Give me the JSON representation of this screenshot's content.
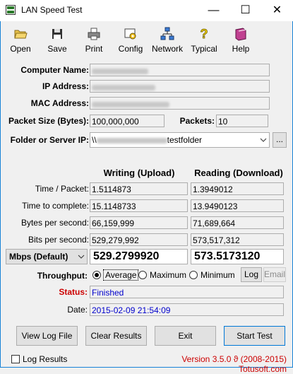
{
  "window": {
    "title": "LAN Speed Test",
    "minimize": "—",
    "maximize": "☐",
    "close": "✕"
  },
  "toolbar": {
    "open": "Open",
    "save": "Save",
    "print": "Print",
    "config": "Config",
    "network": "Network",
    "typical": "Typical",
    "help": "Help"
  },
  "info": {
    "computer_name_label": "Computer Name:",
    "ip_address_label": "IP Address:",
    "mac_address_label": "MAC Address:",
    "packet_size_label": "Packet Size (Bytes):",
    "packet_size_value": "100,000,000",
    "packets_label": "Packets:",
    "packets_value": "10",
    "folder_label": "Folder or Server IP:",
    "folder_prefix": "\\\\",
    "folder_suffix": "testfolder",
    "browse_label": "..."
  },
  "results": {
    "writing_header": "Writing (Upload)",
    "reading_header": "Reading (Download)",
    "time_per_packet_label": "Time / Packet:",
    "time_per_packet_write": "1.5114873",
    "time_per_packet_read": "1.3949012",
    "time_to_complete_label": "Time to complete:",
    "time_to_complete_write": "15.1148733",
    "time_to_complete_read": "13.9490123",
    "bytes_per_second_label": "Bytes per second:",
    "bytes_per_second_write": "66,159,999",
    "bytes_per_second_read": "71,689,664",
    "bits_per_second_label": "Bits per second:",
    "bits_per_second_write": "529,279,992",
    "bits_per_second_read": "573,517,312",
    "unit_select": "Mbps (Default)",
    "mbps_write": "529.2799920",
    "mbps_read": "573.5173120"
  },
  "throughput": {
    "label": "Throughput:",
    "average": "Average",
    "maximum": "Maximum",
    "minimum": "Minimum",
    "log": "Log",
    "email": "Email"
  },
  "status": {
    "status_label": "Status:",
    "status_value": "Finished",
    "date_label": "Date:",
    "date_value": "2015-02-09 21:54:09"
  },
  "buttons": {
    "view_log": "View Log File",
    "clear_results": "Clear Results",
    "exit": "Exit",
    "start_test": "Start Test"
  },
  "footer": {
    "log_results": "Log Results",
    "version": "Version 3.5.0 ϑ (2008-2015) Totusoft.com"
  },
  "colors": {
    "accent": "#0078d7",
    "status_blue": "#0000cc",
    "status_red": "#cc0000"
  }
}
